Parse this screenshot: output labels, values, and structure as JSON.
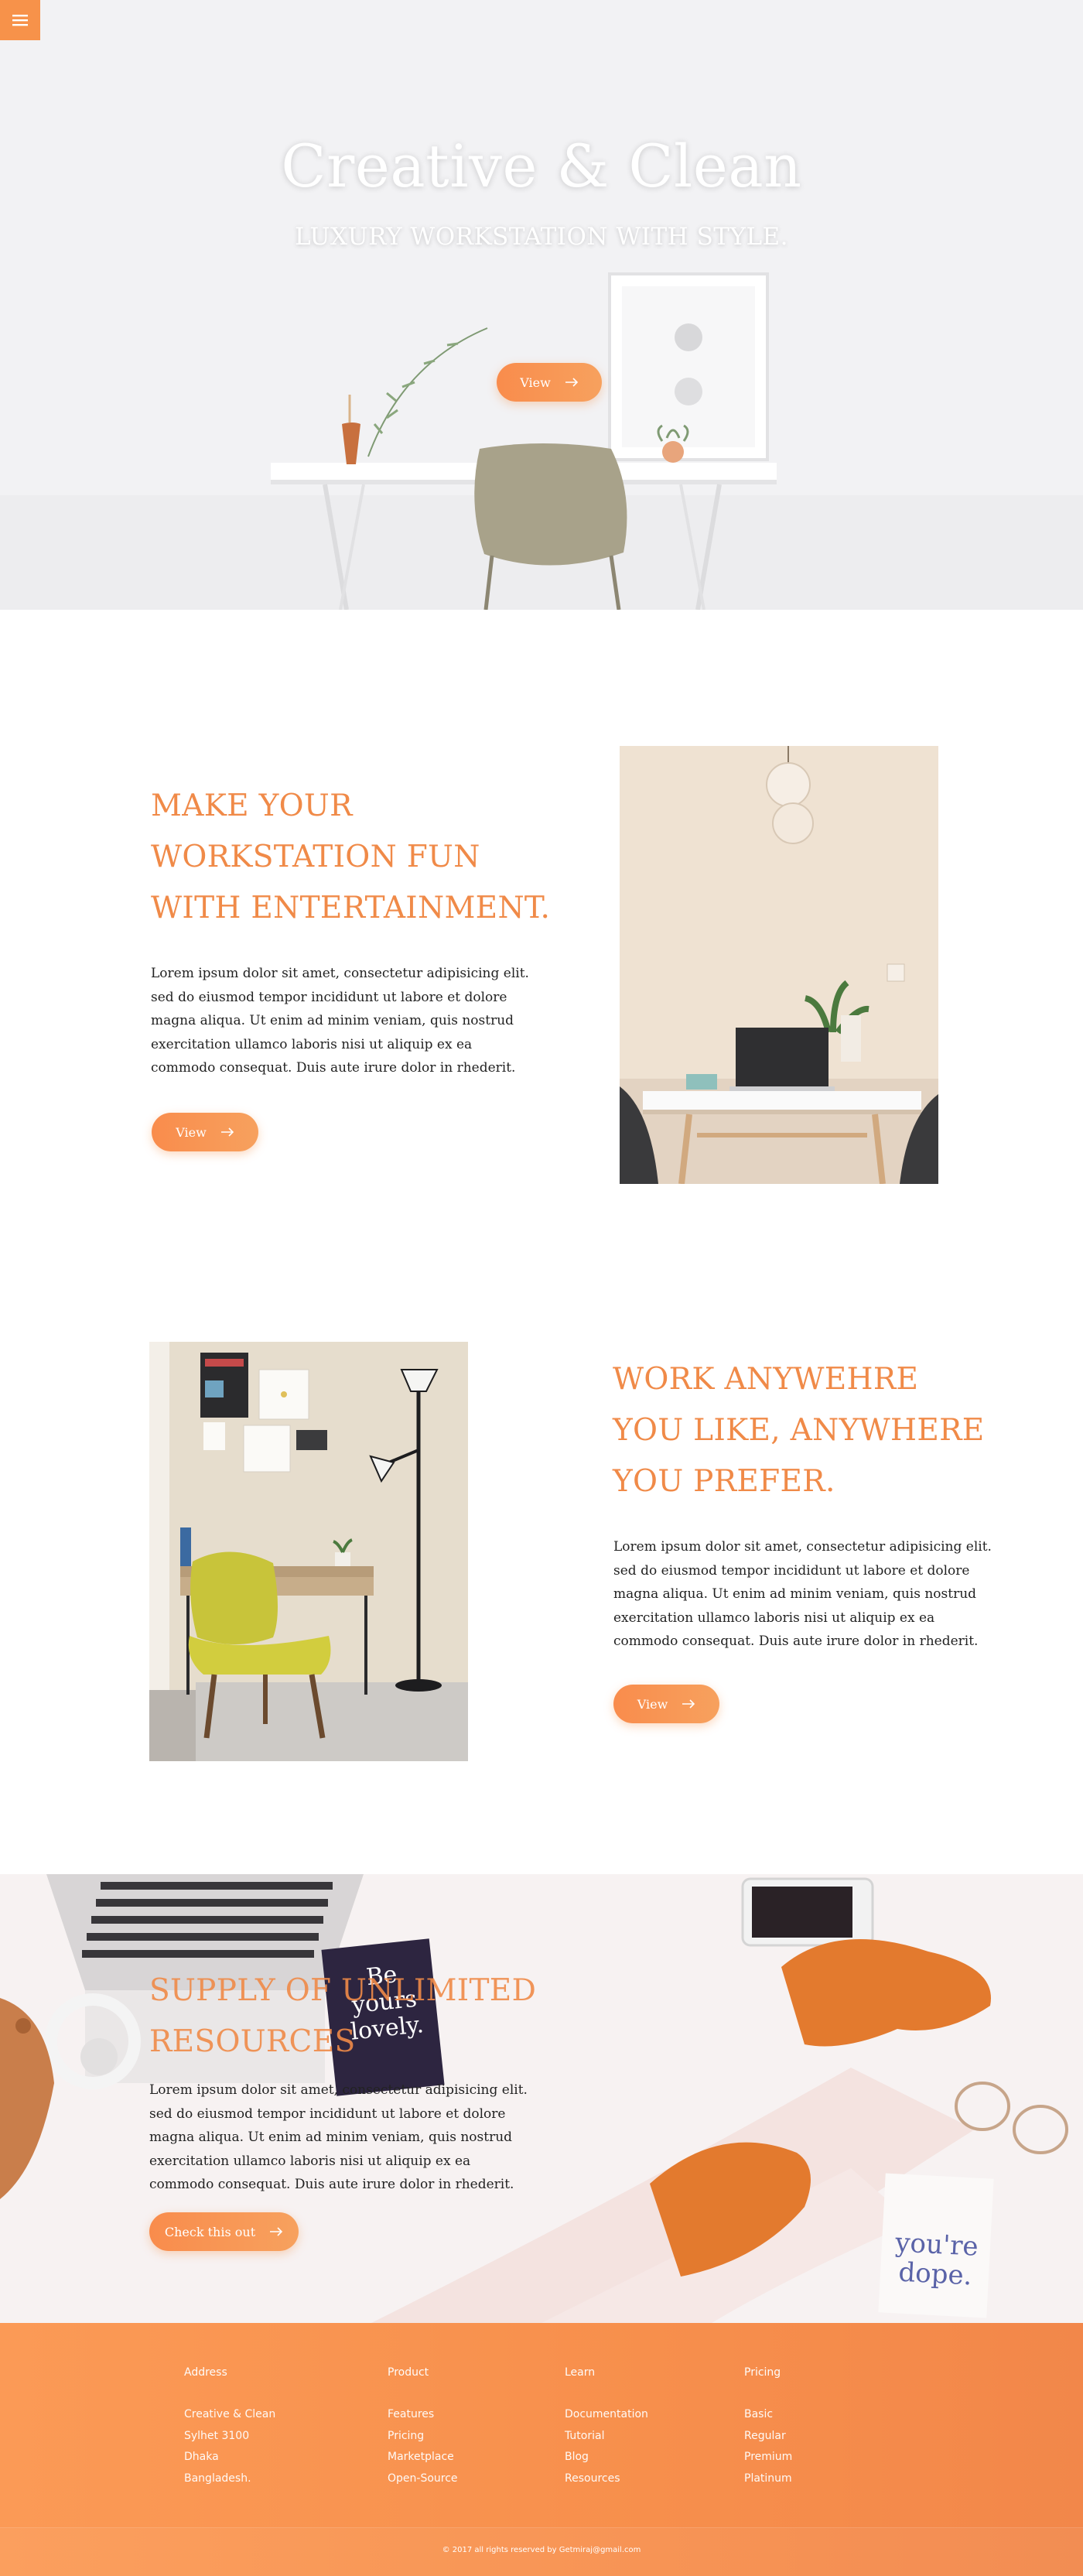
{
  "colors": {
    "accent": "#f7924a",
    "heading": "#f08a48",
    "footer": "#f7904c"
  },
  "nav": {
    "menu_icon": "hamburger-menu-icon"
  },
  "hero": {
    "title": "Creative & Clean",
    "subtitle": "LUXURY WORKSTATION WITH STYLE.",
    "button_label": "View",
    "button_icon": "arrow-right-icon"
  },
  "section1": {
    "title_lines": [
      "MAKE YOUR",
      "WORKSTATION FUN",
      "WITH ENTERTAINMENT."
    ],
    "text_lines": [
      "Lorem ipsum dolor sit amet, consectetur adipisicing elit.",
      "sed do eiusmod tempor incididunt ut labore et dolore",
      "magna aliqua. Ut enim ad minim veniam, quis nostrud",
      "exercitation ullamco laboris nisi ut aliquip ex ea",
      "commodo consequat. Duis aute irure dolor in rhederit."
    ],
    "button_label": "View"
  },
  "section2": {
    "title_lines": [
      "WORK ANYWEHRE",
      "YOU LIKE, ANYWHERE",
      "YOU PREFER."
    ],
    "text_lines": [
      "Lorem ipsum dolor sit amet, consectetur adipisicing elit.",
      "sed do eiusmod tempor incididunt ut labore et dolore",
      "magna aliqua. Ut enim ad minim veniam, quis nostrud",
      "exercitation ullamco laboris nisi ut aliquip ex ea",
      "commodo consequat. Duis aute irure dolor in rhederit."
    ],
    "button_label": "View"
  },
  "section3": {
    "title_lines": [
      "SUPPLY OF UNLIMITED",
      "RESOURCES"
    ],
    "text_lines": [
      "Lorem ipsum dolor sit amet, consectetur adipisicing elit.",
      "sed do eiusmod tempor incididunt ut labore et dolore",
      "magna aliqua. Ut enim ad minim veniam, quis nostrud",
      "exercitation ullamco laboris nisi ut aliquip ex ea",
      "commodo consequat. Duis aute irure dolor in rhederit."
    ],
    "button_label": "Check this out",
    "card_text": "Be yours lovely.",
    "note_text": "you're dope."
  },
  "footer": {
    "columns": [
      {
        "heading": "Address",
        "items": [
          "Creative & Clean",
          "Sylhet 3100",
          "Dhaka",
          "Bangladesh."
        ]
      },
      {
        "heading": "Product",
        "items": [
          "Features",
          "Pricing",
          "Marketplace",
          "Open-Source"
        ]
      },
      {
        "heading": "Learn",
        "items": [
          "Documentation",
          "Tutorial",
          "Blog",
          "Resources"
        ]
      },
      {
        "heading": "Pricing",
        "items": [
          "Basic",
          "Regular",
          "Premium",
          "Platinum"
        ]
      }
    ],
    "copyright": "© 2017 all rights reserved by Getmiraj@gmail.com"
  }
}
